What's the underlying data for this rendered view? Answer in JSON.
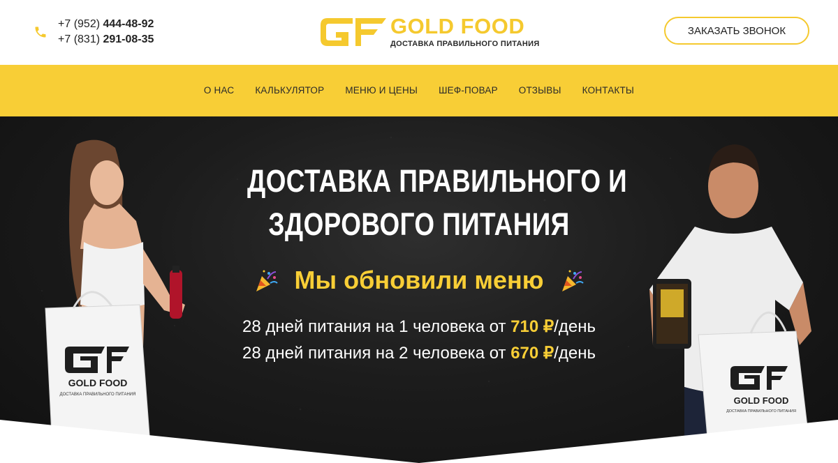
{
  "header": {
    "phones": [
      {
        "prefix": "+7 (952) ",
        "number": "444-48-92"
      },
      {
        "prefix": "+7 (831) ",
        "number": "291-08-35"
      }
    ],
    "logo": {
      "mark": "GF",
      "brand": "GOLD FOOD",
      "tagline": "ДОСТАВКА ПРАВИЛЬНОГО ПИТАНИЯ"
    },
    "call_button": "ЗАКАЗАТЬ ЗВОНОК"
  },
  "nav": {
    "items": [
      "О НАС",
      "КАЛЬКУЛЯТОР",
      "МЕНЮ И ЦЕНЫ",
      "ШЕФ-ПОВАР",
      "ОТЗЫВЫ",
      "КОНТАКТЫ"
    ]
  },
  "hero": {
    "title_lines": [
      "ДОСТАВКА ПРАВИЛЬНОГО И",
      "ЗДОРОВОГО ПИТАНИЯ"
    ],
    "update_text": "Мы обновили меню",
    "update_icon": "party-popper-icon",
    "offers": [
      {
        "before": "28 дней питания на 1 человека от ",
        "price": "710 ₽",
        "after": "/день"
      },
      {
        "before": "28 дней питания на 2 человека от ",
        "price": "670 ₽",
        "after": "/день"
      }
    ],
    "bag_brand": "GOLD FOOD",
    "bag_tagline": "ДОСТАВКА ПРАВИЛЬНОГО ПИТАНИЯ"
  },
  "colors": {
    "accent": "#f8ce36",
    "hero_bg": "#1c1c1c",
    "text_dark": "#222222",
    "white": "#ffffff"
  }
}
